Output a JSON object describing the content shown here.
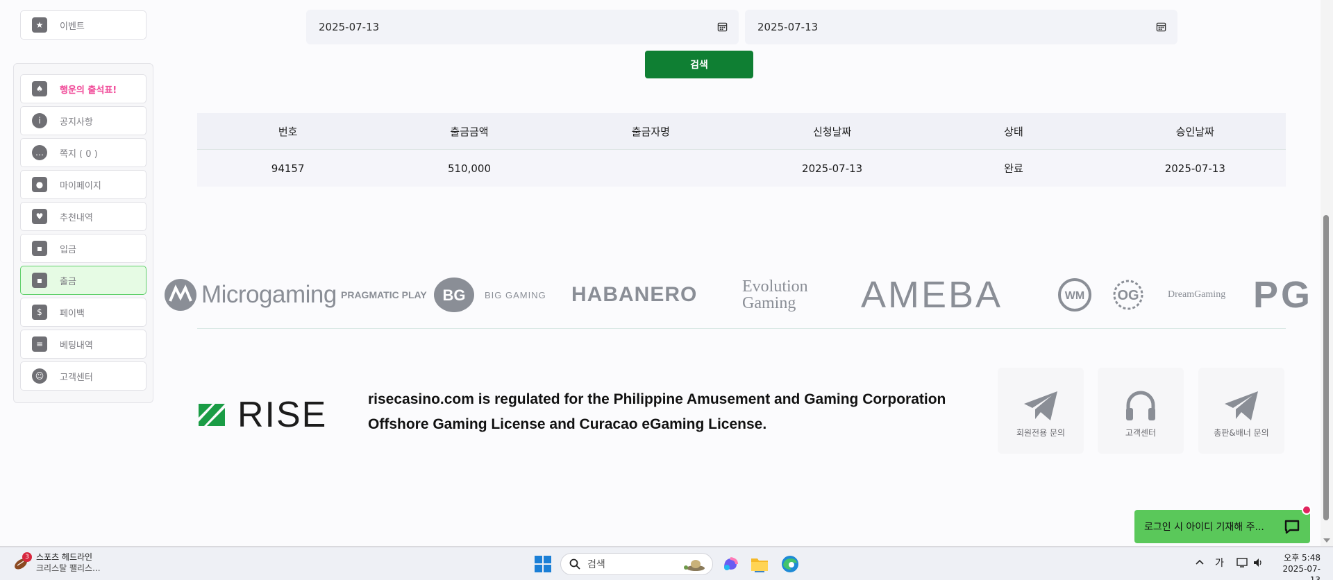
{
  "sidebar": {
    "top_item": "이벤트",
    "items": [
      {
        "label": "행운의 출석표!",
        "icon": "calendar-icon",
        "highlight": true
      },
      {
        "label": "공지사항",
        "icon": "info-icon"
      },
      {
        "label": "쪽지 ( 0 )",
        "icon": "chat-bubble-icon"
      },
      {
        "label": "마이페이지",
        "icon": "user-icon"
      },
      {
        "label": "추천내역",
        "icon": "heart-icon"
      },
      {
        "label": "입금",
        "icon": "wallet-icon"
      },
      {
        "label": "출금",
        "icon": "wallet-icon",
        "active": true
      },
      {
        "label": "페이백",
        "icon": "money-stack-icon"
      },
      {
        "label": "베팅내역",
        "icon": "list-icon"
      },
      {
        "label": "고객센터",
        "icon": "support-icon"
      }
    ]
  },
  "search": {
    "start_date": "2025-07-13",
    "end_date": "2025-07-13",
    "button_label": "검색"
  },
  "table": {
    "headers": [
      "번호",
      "출금금액",
      "출금자명",
      "신청날짜",
      "상태",
      "승인날짜"
    ],
    "rows": [
      [
        "94157",
        "510,000",
        "",
        "2025-07-13",
        "완료",
        "2025-07-13"
      ]
    ]
  },
  "providers": [
    "Microgaming",
    "PRAGMATIC PLAY",
    "BIG GAMING",
    "HABANERO",
    "Evolution Gaming",
    "AMEBA",
    "WM",
    "OG",
    "DreamGaming",
    "PG"
  ],
  "footer": {
    "brand": "RISE",
    "regulation_text": "risecasino.com is regulated for the Philippine Amusement and Gaming Corporation Offshore Gaming License and Curacao eGaming License.",
    "contacts": [
      "회원전용 문의",
      "고객센터",
      "총판&배너 문의"
    ]
  },
  "chat_widget": {
    "label": "로그인 시 아이디 기재해 주..."
  },
  "taskbar": {
    "news_badge": "3",
    "news_title": "스포츠 헤드라인",
    "news_subtitle": "크리스탈 팰리스...",
    "search_placeholder": "검색",
    "ime_label": "가",
    "time": "오후 5:48",
    "date": "2025-07-13"
  },
  "colors": {
    "accent_green": "#0f7f33",
    "active_bg": "#e6fbe4",
    "chat_green": "#5ac85a",
    "highlight_pink": "#f04d9a"
  }
}
